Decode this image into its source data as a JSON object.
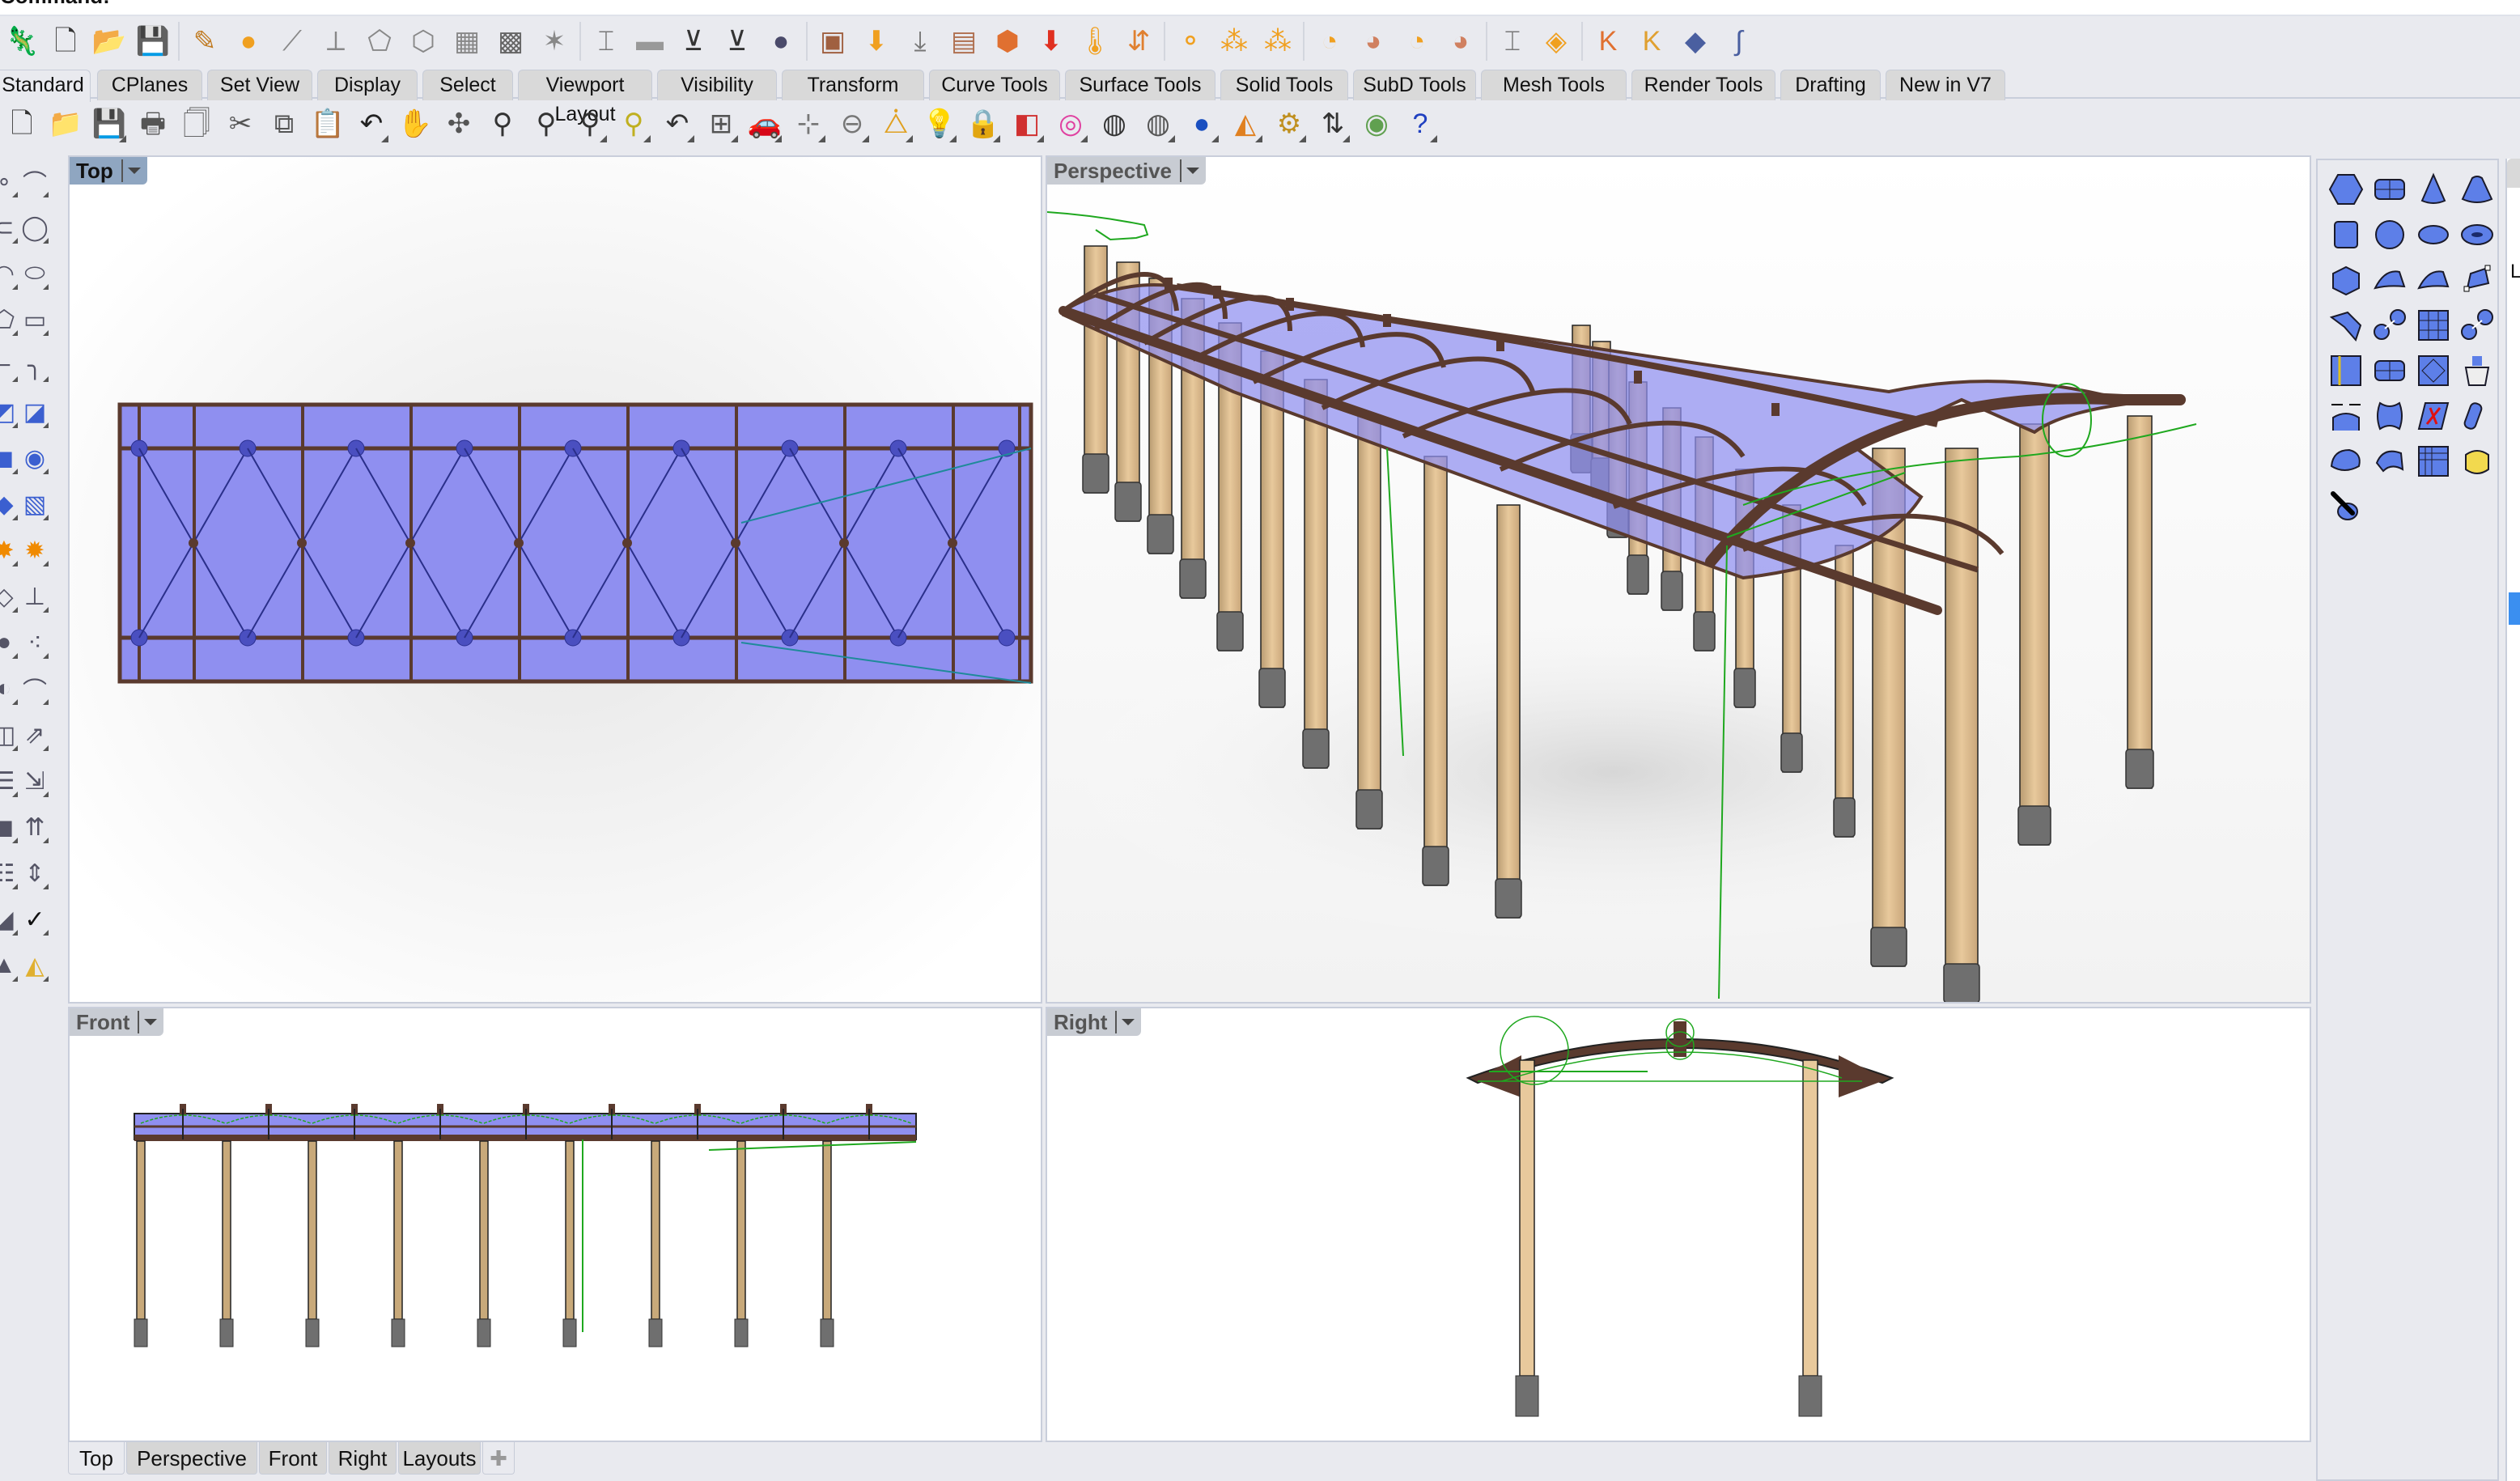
{
  "command_line": {
    "prompt": "Command:"
  },
  "toolbar_main": {
    "buttons": [
      {
        "name": "grasshopper-icon",
        "glyph": "🦎",
        "color": "#d9531e"
      },
      {
        "name": "new-file-icon",
        "glyph": "🗋",
        "color": "#333"
      },
      {
        "name": "open-file-icon",
        "glyph": "📂",
        "color": "#e0b070"
      },
      {
        "name": "save-icon",
        "glyph": "💾",
        "color": "#333"
      },
      {
        "name": "sep"
      },
      {
        "name": "edit-curve-icon",
        "glyph": "✎",
        "color": "#c07a20"
      },
      {
        "name": "add-point-icon",
        "glyph": "●",
        "color": "#f0a020"
      },
      {
        "name": "add-profile-icon",
        "glyph": "⟋",
        "color": "#888"
      },
      {
        "name": "add-rail-icon",
        "glyph": "⟂",
        "color": "#888"
      },
      {
        "name": "add-plate-icon",
        "glyph": "⬠",
        "color": "#888"
      },
      {
        "name": "add-fold-icon",
        "glyph": "⬡",
        "color": "#888"
      },
      {
        "name": "add-grid-icon",
        "glyph": "▦",
        "color": "#888"
      },
      {
        "name": "add-truss-icon",
        "glyph": "▩",
        "color": "#666"
      },
      {
        "name": "add-lattice-icon",
        "glyph": "✶",
        "color": "#888"
      },
      {
        "name": "sep"
      },
      {
        "name": "add-ibeam-icon",
        "glyph": "⌶",
        "color": "#777"
      },
      {
        "name": "add-flat-bar-icon",
        "glyph": "▬",
        "color": "#999"
      },
      {
        "name": "add-support-icon",
        "glyph": "⊻",
        "color": "#333"
      },
      {
        "name": "add-support-alt-icon",
        "glyph": "⊻",
        "color": "#333"
      },
      {
        "name": "add-sphere-icon",
        "glyph": "●",
        "color": "#4a4a6a"
      },
      {
        "name": "sep"
      },
      {
        "name": "add-load-icon",
        "glyph": "▣",
        "color": "#a06040"
      },
      {
        "name": "add-point-load-icon",
        "glyph": "⬇",
        "color": "#f0a020"
      },
      {
        "name": "add-line-load-icon",
        "glyph": "⤓",
        "color": "#777"
      },
      {
        "name": "add-area-load-icon",
        "glyph": "▤",
        "color": "#b07050"
      },
      {
        "name": "add-mesh-load-icon",
        "glyph": "⬢",
        "color": "#e07030"
      },
      {
        "name": "add-gravity-icon",
        "glyph": "⬇",
        "color": "#e03020"
      },
      {
        "name": "add-temperature-icon",
        "glyph": "🌡",
        "color": "#f0a020"
      },
      {
        "name": "add-prestress-icon",
        "glyph": "⇵",
        "color": "#e08030"
      },
      {
        "name": "sep"
      },
      {
        "name": "analysis-point-icon",
        "glyph": "⚬",
        "color": "#f0a020"
      },
      {
        "name": "analysis-cluster-icon",
        "glyph": "⁂",
        "color": "#f0a020"
      },
      {
        "name": "analysis-network-icon",
        "glyph": "⁂",
        "color": "#f0a020"
      },
      {
        "name": "sep"
      },
      {
        "name": "result-disp-icon",
        "glyph": "◔",
        "color": "#f0a020"
      },
      {
        "name": "result-stress-icon",
        "glyph": "◕",
        "color": "#d08060"
      },
      {
        "name": "result-force-icon",
        "glyph": "◔",
        "color": "#f0a020"
      },
      {
        "name": "result-moment-icon",
        "glyph": "◕",
        "color": "#d08060"
      },
      {
        "name": "sep"
      },
      {
        "name": "section-icon",
        "glyph": "⌶",
        "color": "#777"
      },
      {
        "name": "material-icon",
        "glyph": "◈",
        "color": "#f0a020"
      },
      {
        "name": "sep"
      },
      {
        "name": "karamba-icon",
        "glyph": "K",
        "color": "#e07030"
      },
      {
        "name": "karamba-export-icon",
        "glyph": "K",
        "color": "#e0a030"
      },
      {
        "name": "gsa-icon",
        "glyph": "◆",
        "color": "#4a5fa0"
      },
      {
        "name": "etabs-icon",
        "glyph": "∫",
        "color": "#4a5fa0"
      }
    ]
  },
  "tabs": {
    "items": [
      {
        "label": "Standard",
        "active": true
      },
      {
        "label": "CPlanes"
      },
      {
        "label": "Set View"
      },
      {
        "label": "Display"
      },
      {
        "label": "Select"
      },
      {
        "label": "Viewport Layout"
      },
      {
        "label": "Visibility"
      },
      {
        "label": "Transform"
      },
      {
        "label": "Curve Tools"
      },
      {
        "label": "Surface Tools"
      },
      {
        "label": "Solid Tools"
      },
      {
        "label": "SubD Tools"
      },
      {
        "label": "Mesh Tools"
      },
      {
        "label": "Render Tools"
      },
      {
        "label": "Drafting"
      },
      {
        "label": "New in V7"
      }
    ]
  },
  "toolbar_standard": {
    "buttons": [
      {
        "name": "new-icon",
        "glyph": "🗋",
        "color": "#333"
      },
      {
        "name": "open-icon",
        "glyph": "📁",
        "color": "#e0b020"
      },
      {
        "name": "save-icon",
        "glyph": "💾",
        "color": "#a0a050",
        "flyout": true
      },
      {
        "name": "print-icon",
        "glyph": "🖶",
        "color": "#555"
      },
      {
        "name": "export-icon",
        "glyph": "🗍",
        "color": "#555"
      },
      {
        "name": "cut-icon",
        "glyph": "✂",
        "color": "#555"
      },
      {
        "name": "copy-icon",
        "glyph": "⧉",
        "color": "#555"
      },
      {
        "name": "paste-icon",
        "glyph": "📋",
        "color": "#e0b020"
      },
      {
        "name": "undo-icon",
        "glyph": "↶",
        "color": "#222",
        "flyout": true
      },
      {
        "name": "pan-icon",
        "glyph": "✋",
        "color": "#555"
      },
      {
        "name": "rotate-view-icon",
        "glyph": "✣",
        "color": "#555"
      },
      {
        "name": "zoom-dynamic-icon",
        "glyph": "⚲",
        "color": "#333"
      },
      {
        "name": "zoom-window-icon",
        "glyph": "⚲",
        "color": "#333"
      },
      {
        "name": "zoom-extents-icon",
        "glyph": "⚲",
        "color": "#333",
        "flyout": true
      },
      {
        "name": "zoom-selected-icon",
        "glyph": "⚲",
        "color": "#c0b020",
        "flyout": true
      },
      {
        "name": "undo-view-icon",
        "glyph": "↶",
        "color": "#333",
        "flyout": true
      },
      {
        "name": "four-viewports-icon",
        "glyph": "⊞",
        "color": "#555",
        "flyout": true
      },
      {
        "name": "named-views-icon",
        "glyph": "🚗",
        "color": "#d01010",
        "flyout": true
      },
      {
        "name": "cplane-icon",
        "glyph": "⊹",
        "color": "#777",
        "flyout": true
      },
      {
        "name": "osnap-icon",
        "glyph": "⊖",
        "color": "#777",
        "flyout": true
      },
      {
        "name": "select-objects-icon",
        "glyph": "⧊",
        "color": "#e0a020",
        "flyout": true
      },
      {
        "name": "light-icon",
        "glyph": "💡",
        "color": "#888",
        "flyout": true
      },
      {
        "name": "lock-icon",
        "glyph": "🔒",
        "color": "#666",
        "flyout": true
      },
      {
        "name": "layer-icon",
        "glyph": "◧",
        "color": "#d03030",
        "flyout": true
      },
      {
        "name": "color-wheel-icon",
        "glyph": "◎",
        "color": "#e040a0",
        "flyout": true
      },
      {
        "name": "shaded-icon",
        "glyph": "◍",
        "color": "#333"
      },
      {
        "name": "wireframe-icon",
        "glyph": "◍",
        "color": "#555",
        "flyout": true
      },
      {
        "name": "rendered-icon",
        "glyph": "●",
        "color": "#1a4fc0",
        "flyout": true
      },
      {
        "name": "render-icon",
        "glyph": "◭",
        "color": "#e08020",
        "flyout": true
      },
      {
        "name": "options-icon",
        "glyph": "⚙",
        "color": "#c09020",
        "flyout": true
      },
      {
        "name": "dimension-icon",
        "glyph": "⇅",
        "color": "#333",
        "flyout": true
      },
      {
        "name": "sketch-icon",
        "glyph": "◉",
        "color": "#60a050"
      },
      {
        "name": "help-icon",
        "glyph": "?",
        "color": "#2040c0",
        "flyout": true
      }
    ]
  },
  "left_toolbar": {
    "buttons": [
      {
        "name": "point-icon",
        "glyph": "∘"
      },
      {
        "name": "polyline-icon",
        "glyph": "⌒"
      },
      {
        "name": "curve-icon",
        "glyph": "⊂"
      },
      {
        "name": "circle-icon",
        "glyph": "◯"
      },
      {
        "name": "arc-icon",
        "glyph": "◠"
      },
      {
        "name": "ellipse-icon",
        "glyph": "⬭"
      },
      {
        "name": "polygon-icon",
        "glyph": "⬠"
      },
      {
        "name": "rectangle-icon",
        "glyph": "▭"
      },
      {
        "name": "freeform-icon",
        "glyph": "⌐"
      },
      {
        "name": "fillet-icon",
        "glyph": "╮"
      },
      {
        "name": "surface-icon",
        "glyph": "◩"
      },
      {
        "name": "extrude-icon",
        "glyph": "◪"
      },
      {
        "name": "box-icon",
        "glyph": "◼"
      },
      {
        "name": "sphere-union-icon",
        "glyph": "◉"
      },
      {
        "name": "plane-icon",
        "glyph": "◆"
      },
      {
        "name": "mesh-icon",
        "glyph": "▧"
      },
      {
        "name": "explode-icon",
        "glyph": "✸"
      },
      {
        "name": "boolean-icon",
        "glyph": "✹"
      },
      {
        "name": "trim-icon",
        "glyph": "◇"
      },
      {
        "name": "split-icon",
        "glyph": "⊥"
      },
      {
        "name": "group-icon",
        "glyph": "●"
      },
      {
        "name": "ungroup-icon",
        "glyph": "⁖"
      },
      {
        "name": "offset-icon",
        "glyph": "◐"
      },
      {
        "name": "curve-offset-icon",
        "glyph": "⌒"
      },
      {
        "name": "move-icon",
        "glyph": "◫"
      },
      {
        "name": "copy-move-icon",
        "glyph": "⇗"
      },
      {
        "name": "align-icon",
        "glyph": "☰"
      },
      {
        "name": "project-icon",
        "glyph": "⇲"
      },
      {
        "name": "cube-icon",
        "glyph": "◼"
      },
      {
        "name": "array-icon",
        "glyph": "⇈"
      },
      {
        "name": "distribute-icon",
        "glyph": "☷"
      },
      {
        "name": "mirror-icon",
        "glyph": "⇕"
      },
      {
        "name": "analyze-icon",
        "glyph": "◢"
      },
      {
        "name": "check-icon",
        "glyph": "✓"
      },
      {
        "name": "cone-icon",
        "glyph": "▲"
      },
      {
        "name": "render-preview-icon",
        "glyph": "◭"
      }
    ]
  },
  "viewports": {
    "top": {
      "label": "Top",
      "active": true
    },
    "perspective": {
      "label": "Perspective"
    },
    "front": {
      "label": "Front"
    },
    "right": {
      "label": "Right"
    }
  },
  "bottom_tabs": {
    "items": [
      {
        "label": "Top",
        "active": true
      },
      {
        "label": "Perspective"
      },
      {
        "label": "Front"
      },
      {
        "label": "Right"
      },
      {
        "label": "Layouts"
      }
    ],
    "add_glyph": "✚"
  },
  "right_panel": {
    "buttons": [
      "solid-box-icon",
      "solid-slab-icon",
      "solid-cone-icon",
      "solid-truncated-cone-icon",
      "solid-cylinder-icon",
      "solid-sphere-icon",
      "solid-ellipsoid-icon",
      "solid-torus-icon",
      "solid-pipe-icon",
      "solid-extrude-surface-icon",
      "solid-extrude-curve-icon",
      "solid-cage-icon",
      "solid-fillet-edge-icon",
      "solid-boolean-union-icon",
      "solid-boolean-difference-icon",
      "solid-boolean-split-icon",
      "solid-shell-icon",
      "solid-cap-icon",
      "solid-extract-surface-icon",
      "solid-cup-icon",
      "solid-join-icon",
      "solid-sweep-icon",
      "solid-trim-icon",
      "solid-eraser-icon",
      "solid-fillet-icon",
      "solid-chamfer-icon",
      "solid-mesh-icon",
      "solid-subd-icon",
      "solid-tools-icon"
    ],
    "side_letter": "L"
  },
  "colors": {
    "canopy_blue": "#8f8ff0",
    "frame_brown": "#5a3a2e",
    "column_wood": "#e8c99c",
    "footing_gray": "#6f6f6f",
    "construction_green": "#1fa81f",
    "ui_bg": "#e9eaef",
    "active_label": "#8fa6c1"
  }
}
